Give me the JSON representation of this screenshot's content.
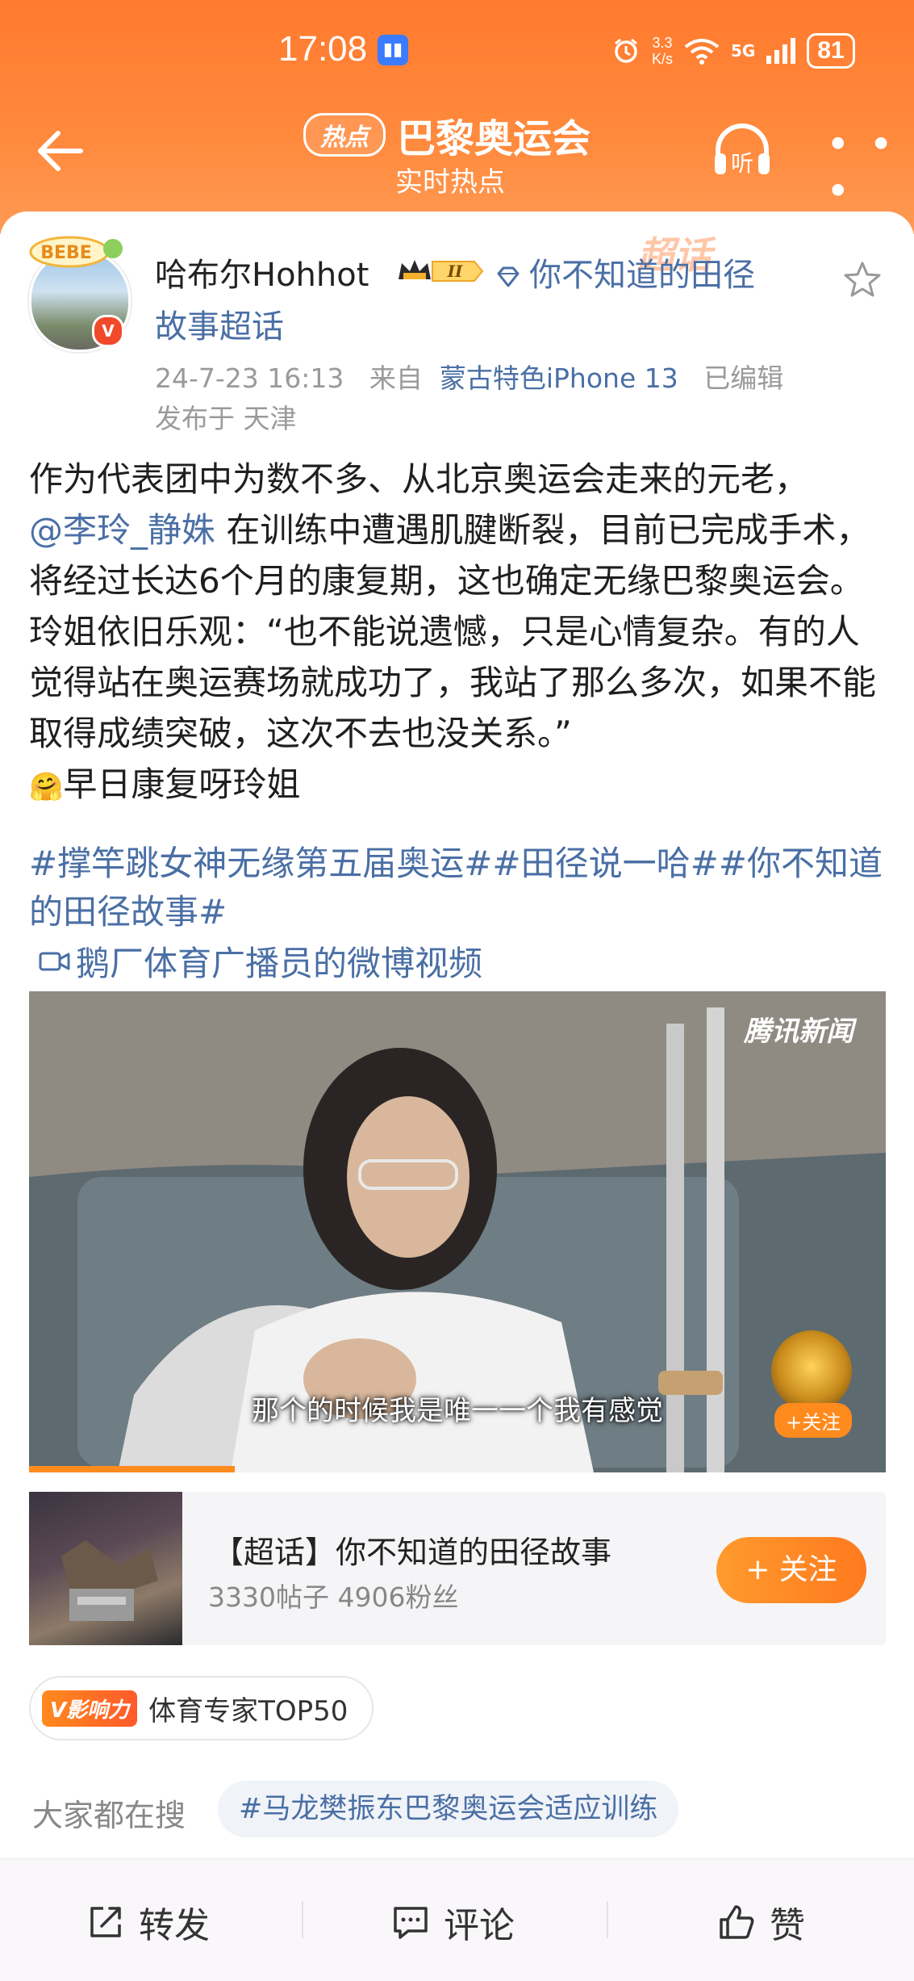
{
  "status_bar": {
    "time": "17:08",
    "net_speed_value": "3.3",
    "net_speed_unit": "K/s",
    "network": "5G",
    "battery": "81"
  },
  "nav": {
    "badge": "热点",
    "title": "巴黎奥运会",
    "subtitle": "实时热点",
    "listen_label": "听"
  },
  "post": {
    "username": "哈布尔Hohhot",
    "vip_level": "II",
    "avatar_badge_text": "BEBE",
    "topic_line1": "你不知道的田径",
    "topic_line2": "故事超话",
    "watermark": "超话",
    "timestamp": "24-7-23 16:13",
    "from_label": "来自",
    "device": "蒙古特色iPhone 13",
    "edited": "已编辑",
    "location": "发布于 天津",
    "text_p1a": "作为代表团中为数不多、从北京奥运会走来的元老，",
    "mention": "@李玲_静姝",
    "text_p1b": " 在训练中遭遇肌腱断裂，目前已完成手术，将经过长达6个月的康复期，这也确定无缘巴黎奥运会。",
    "text_p2": "玲姐依旧乐观：“也不能说遗憾，只是心情复杂。有的人觉得站在奥运赛场就成功了，我站了那么多次，如果不能取得成绩突破，这次不去也没关系。”",
    "text_p3_emoji": "🤗",
    "text_p3": "早日康复呀玲姐",
    "hashtags": "#撑竿跳女神无缘第五届奥运##田径说一哈##你不知道的田径故事#",
    "video_link": "鹅厂体育广播员的微博视频"
  },
  "video": {
    "brand": "腾讯新闻",
    "subtitle": "那个的时候我是唯一一个我有感觉",
    "follow_label": "+关注",
    "progress": 0.24
  },
  "super_topic_card": {
    "title": "【超话】你不知道的田径故事",
    "stats": "3330帖子 4906粉丝",
    "follow_label": "+ 关注"
  },
  "influence": {
    "badge": "V影响力",
    "text": "体育专家TOP50"
  },
  "search": {
    "label": "大家都在搜",
    "chip": "#马龙樊振东巴黎奥运会适应训练"
  },
  "actions": {
    "repost": "转发",
    "comment": "评论",
    "like": "赞"
  },
  "colors": {
    "header_orange": "#ff7a2e",
    "link_blue": "#4a6fa5",
    "follow_orange": "#ff8a1e"
  },
  "icons": [
    "back-icon",
    "headphone-icon",
    "more-icon",
    "star-icon",
    "gem-icon",
    "video-camera-icon",
    "repost-icon",
    "comment-icon",
    "like-icon"
  ]
}
